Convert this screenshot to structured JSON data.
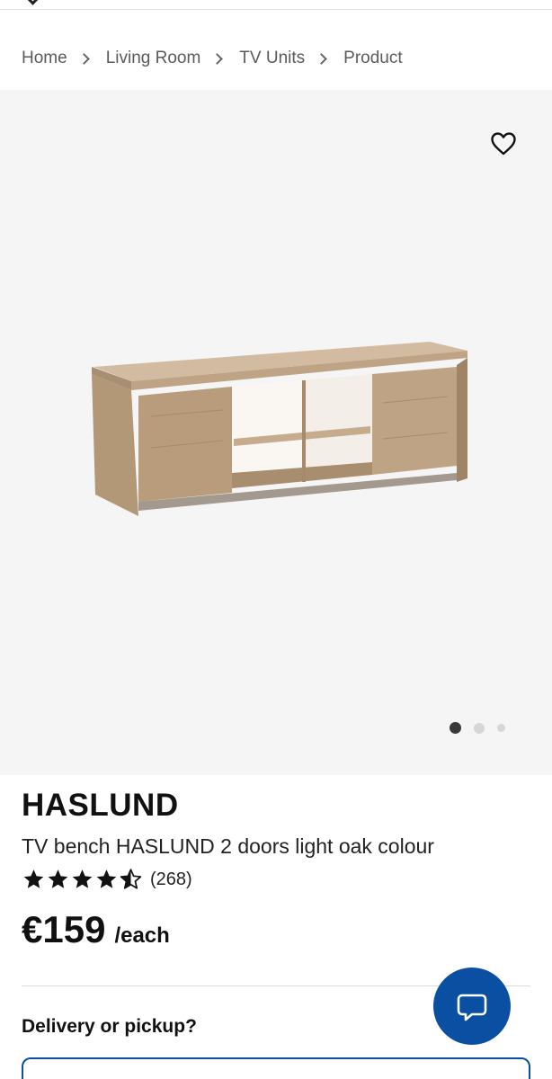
{
  "breadcrumb": {
    "items": [
      "Home",
      "Living Room",
      "TV Units",
      "Product"
    ]
  },
  "gallery": {
    "image_count": 3,
    "active_index": 0
  },
  "product": {
    "brand": "HASLUND",
    "description": "TV bench HASLUND 2 doors light oak colour",
    "rating": 4.5,
    "rating_max": 5,
    "review_count": "(268)",
    "price": "€159",
    "price_unit": "/each"
  },
  "delivery": {
    "heading": "Delivery or pickup?"
  },
  "icons": {
    "favorite": "heart-outline-icon",
    "chat": "chat-bubble-icon",
    "star": "star-icon"
  },
  "colors": {
    "accent_blue": "#0b4fa3",
    "gallery_bg": "#f5f5f5",
    "text": "#111111"
  }
}
